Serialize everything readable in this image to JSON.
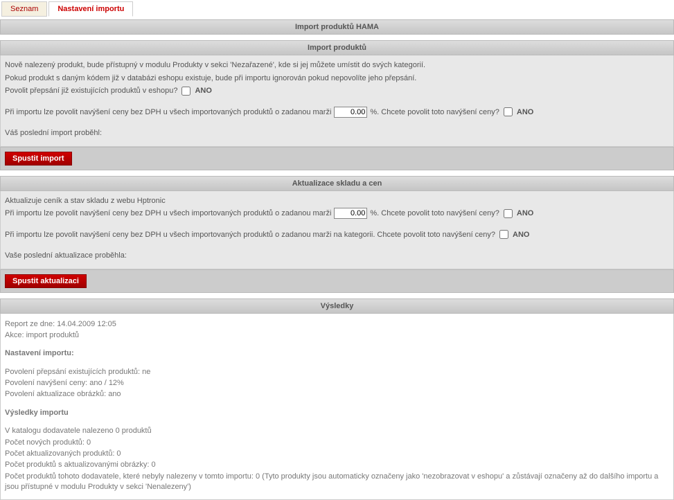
{
  "tabs": {
    "list": "Seznam",
    "settings": "Nastavení importu"
  },
  "page_title": "Import produktů HAMA",
  "section_import": {
    "title": "Import produktů",
    "line1": "Nově nalezený produkt, bude přístupný v modulu Produkty v sekci 'Nezařazené', kde si jej můžete umístit do svých kategorií.",
    "line2": "Pokud produkt s daným kódem již v databázi eshopu existuje, bude při importu ignorován pokud nepovolíte jeho přepsání.",
    "overwrite_label": "Povolit přepsání již existujících produktů v eshopu?",
    "margin_label_pre": "Při importu lze povolit navýšení ceny bez DPH u všech importovaných produktů o zadanou marži",
    "margin_value": "0.00",
    "margin_label_post": "%. Chcete povolit toto navýšení ceny?",
    "ano": "ANO",
    "last_import": "Váš poslední import proběhl:",
    "button": "Spustit import"
  },
  "section_update": {
    "title": "Aktualizace skladu a cen",
    "line1": "Aktualizuje ceník a stav skladu z webu Hptronic",
    "margin_label_pre": "Při importu lze povolit navýšení ceny bez DPH u všech importovaných produktů o zadanou marži",
    "margin_value": "0.00",
    "margin_label_post": "%. Chcete povolit toto navýšení ceny?",
    "margin_cat_label": "Při importu lze povolit navýšení ceny bez DPH u všech importovaných produktů o zadanou marži na kategorii. Chcete povolit toto navýšení ceny?",
    "ano": "ANO",
    "last_update": "Vaše poslední aktualizace proběhla:",
    "button": "Spustit aktualizaci"
  },
  "section_results": {
    "title": "Výsledky",
    "report_date": "Report ze dne: 14.04.2009 12:05",
    "action": "Akce: import produktů",
    "settings_h": "Nastavení importu:",
    "s1": "Povolení přepsání existujících produktů: ne",
    "s2": "Povolení navýšení ceny: ano / 12%",
    "s3": "Povolení aktualizace obrázků: ano",
    "results_h": "Výsledky importu",
    "r1": "V katalogu dodavatele nalezeno 0 produktů",
    "r2": "Počet nových produktů: 0",
    "r3": "Počet aktualizovaných produktů: 0",
    "r4": "Počet produktů s aktualizovanými obrázky: 0",
    "r5": "Počet produktů tohoto dodavatele, které nebyly nalezeny v tomto importu: 0 (Tyto produkty jsou automaticky označeny jako 'nezobrazovat v eshopu' a zůstávají označeny až do dalšího importu a jsou přístupné v modulu Produkty v sekci 'Nenalezeny')"
  }
}
